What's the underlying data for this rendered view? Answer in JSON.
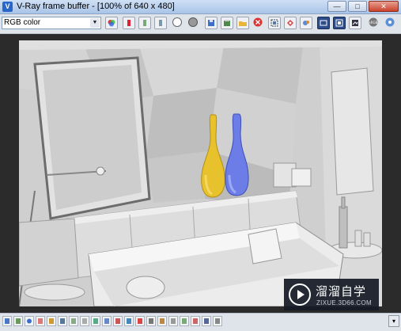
{
  "window": {
    "title": "V-Ray frame buffer - [100% of 640 x 480]",
    "app_icon": "vray-icon",
    "buttons": [
      "minimize",
      "maximize",
      "close"
    ],
    "button_glyphs": {
      "minimize": "—",
      "maximize": "□",
      "close": "✕"
    }
  },
  "toolbar": {
    "channel": "RGB color",
    "tools": [
      {
        "name": "color-channels-icon"
      },
      {
        "name": "red-channel-icon"
      },
      {
        "name": "green-channel-icon"
      },
      {
        "name": "blue-channel-icon"
      },
      {
        "name": "alpha-icon"
      },
      {
        "name": "mono-icon"
      },
      {
        "name": "save-image-icon"
      },
      {
        "name": "load-image-icon"
      },
      {
        "name": "open-folder-icon"
      },
      {
        "name": "clear-image-icon"
      },
      {
        "name": "region-render-icon"
      },
      {
        "name": "track-mouse-icon"
      },
      {
        "name": "pixel-info-icon"
      },
      {
        "name": "show-vfb-history-icon"
      },
      {
        "name": "lens-effects-icon"
      },
      {
        "name": "color-correction-icon"
      },
      {
        "name": "srgb-icon"
      },
      {
        "name": "stamp-icon"
      }
    ]
  },
  "statusbar": {
    "tools": [
      "layers-icon",
      "history-icon",
      "info-icon",
      "color-icon",
      "levels-icon",
      "curve-icon",
      "exposure-icon",
      "background-icon",
      "lut-icon",
      "ocio-icon",
      "zoom-icon",
      "pan-icon",
      "display-icon",
      "stamp-icon",
      "detail-icon",
      "grid-icon",
      "compare-icon",
      "flag-icon",
      "help-icon",
      "settings-icon"
    ],
    "scroll_glyph": "▾"
  },
  "watermark": {
    "main": "溜溜自学",
    "sub": "ZIXUE.3D66.COM"
  },
  "colors": {
    "yellow_vase": "#e8c22c",
    "blue_vase": "#6c7de8",
    "render_bg": "#c8c8c8",
    "frame": "#2b2b2b"
  }
}
